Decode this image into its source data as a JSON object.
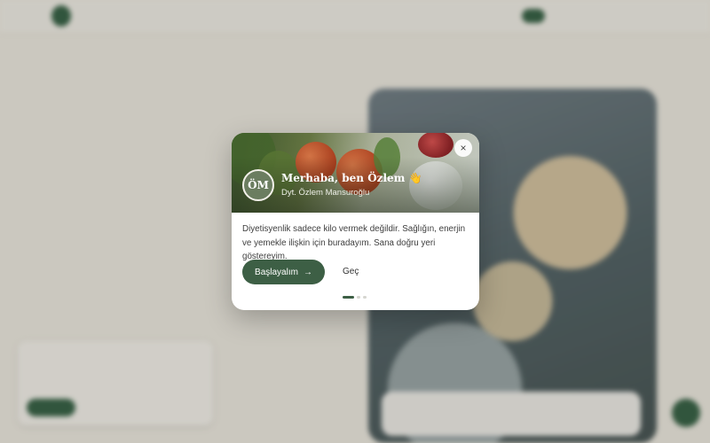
{
  "modal": {
    "avatar_initials": "ÖM",
    "greeting": "Merhaba, ben Özlem 👋",
    "subtitle": "Dyt. Özlem Mansuroğlu",
    "body": "Diyetisyenlik sadece kilo vermek değildir. Sağlığın, enerjin ve yemekle ilişkin için buradayım. Sana doğru yeri göstereyim.",
    "start_label": "Başlayalım",
    "skip_label": "Geç",
    "close_glyph": "×",
    "arrow_glyph": "→",
    "steps_total": 3,
    "current_step": 1,
    "accent_color": "#3d5f45"
  }
}
